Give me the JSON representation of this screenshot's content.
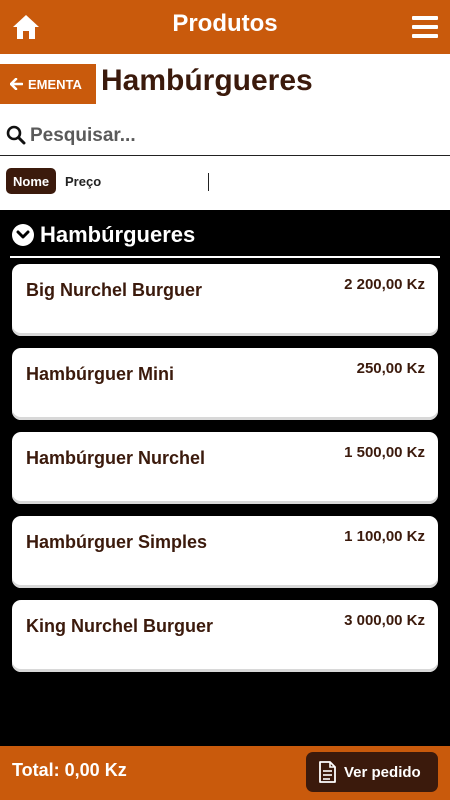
{
  "topbar": {
    "title": "Produtos",
    "home_icon": "home-icon",
    "menu_icon": "hamburger-menu-icon"
  },
  "header": {
    "back_label": "EMENTA",
    "back_icon": "arrow-left-icon",
    "page_title": "Hambúrgueres"
  },
  "search": {
    "placeholder": "Pesquisar...",
    "value": "",
    "icon": "search-icon"
  },
  "sort": {
    "options": [
      "Nome",
      "Preço"
    ],
    "selected": "Nome"
  },
  "section": {
    "title": "Hambúrgueres",
    "icon": "chevron-down-circle-icon"
  },
  "products": [
    {
      "name": "Big Nurchel Burguer",
      "price": "2 200,00 Kz"
    },
    {
      "name": "Hambúrguer Mini",
      "price": "250,00 Kz"
    },
    {
      "name": "Hambúrguer Nurchel",
      "price": "1 500,00 Kz"
    },
    {
      "name": "Hambúrguer Simples",
      "price": "1 100,00 Kz"
    },
    {
      "name": "King Nurchel Burguer",
      "price": "3 000,00 Kz"
    }
  ],
  "footer": {
    "total": "Total: 0,00 Kz",
    "order_label": "Ver pedido",
    "order_icon": "document-icon"
  },
  "colors": {
    "primary": "#c95a0c",
    "dark": "#3b1a0c",
    "background": "#000000",
    "card": "#ffffff"
  }
}
